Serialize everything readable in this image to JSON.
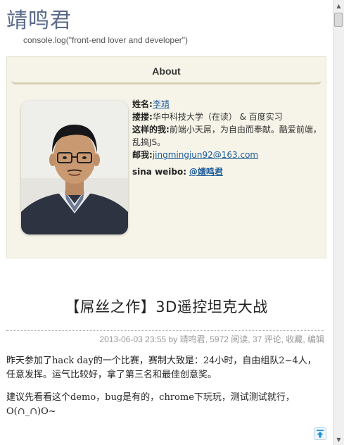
{
  "site": {
    "title": "靖鸣君",
    "subtitle": "console.log(\"front-end lover and developer\")"
  },
  "about": {
    "heading": "About",
    "name_label": "姓名:",
    "name_value": "李靖",
    "school_label": "搂搂:",
    "school_value": "华中科技大学（在读）  & 百度实习",
    "self_label": "这样的我:",
    "self_value": "前端小天屌，为自由而奉献。酷爱前端，乱搞JS。",
    "email_label": "邮我:",
    "email_value": "jingmingjun92@163.com",
    "weibo_label": "sina weibo:",
    "weibo_value": "@靖鸣君"
  },
  "post": {
    "title": "【屌丝之作】3D遥控坦克大战",
    "meta_date": "2013-06-03 23:55",
    "meta_by": "by",
    "meta_author": "靖鸣君",
    "meta_reads": "5972 阅读",
    "meta_comments": "37 评论",
    "meta_fav": "收藏",
    "meta_edit": "编辑",
    "para1": "昨天参加了hack day的一个比赛，赛制大致是：24小时，自由组队2~4人，任意发挥。运气比较好，拿了第三名和最佳创意奖。",
    "para2": "建议先看看这个demo，bug是有的，chrome下玩玩，测试测试就行，O(∩_∩)O~"
  },
  "icons": {
    "to_top": "arrow-up-to-top-icon",
    "scroll_up": "scroll-up-arrow",
    "scroll_down": "scroll-down-arrow"
  },
  "colors": {
    "title": "#5a6a8a",
    "about_bg": "#f6f4e8",
    "link": "#1a5a9a",
    "meta": "#999999"
  }
}
